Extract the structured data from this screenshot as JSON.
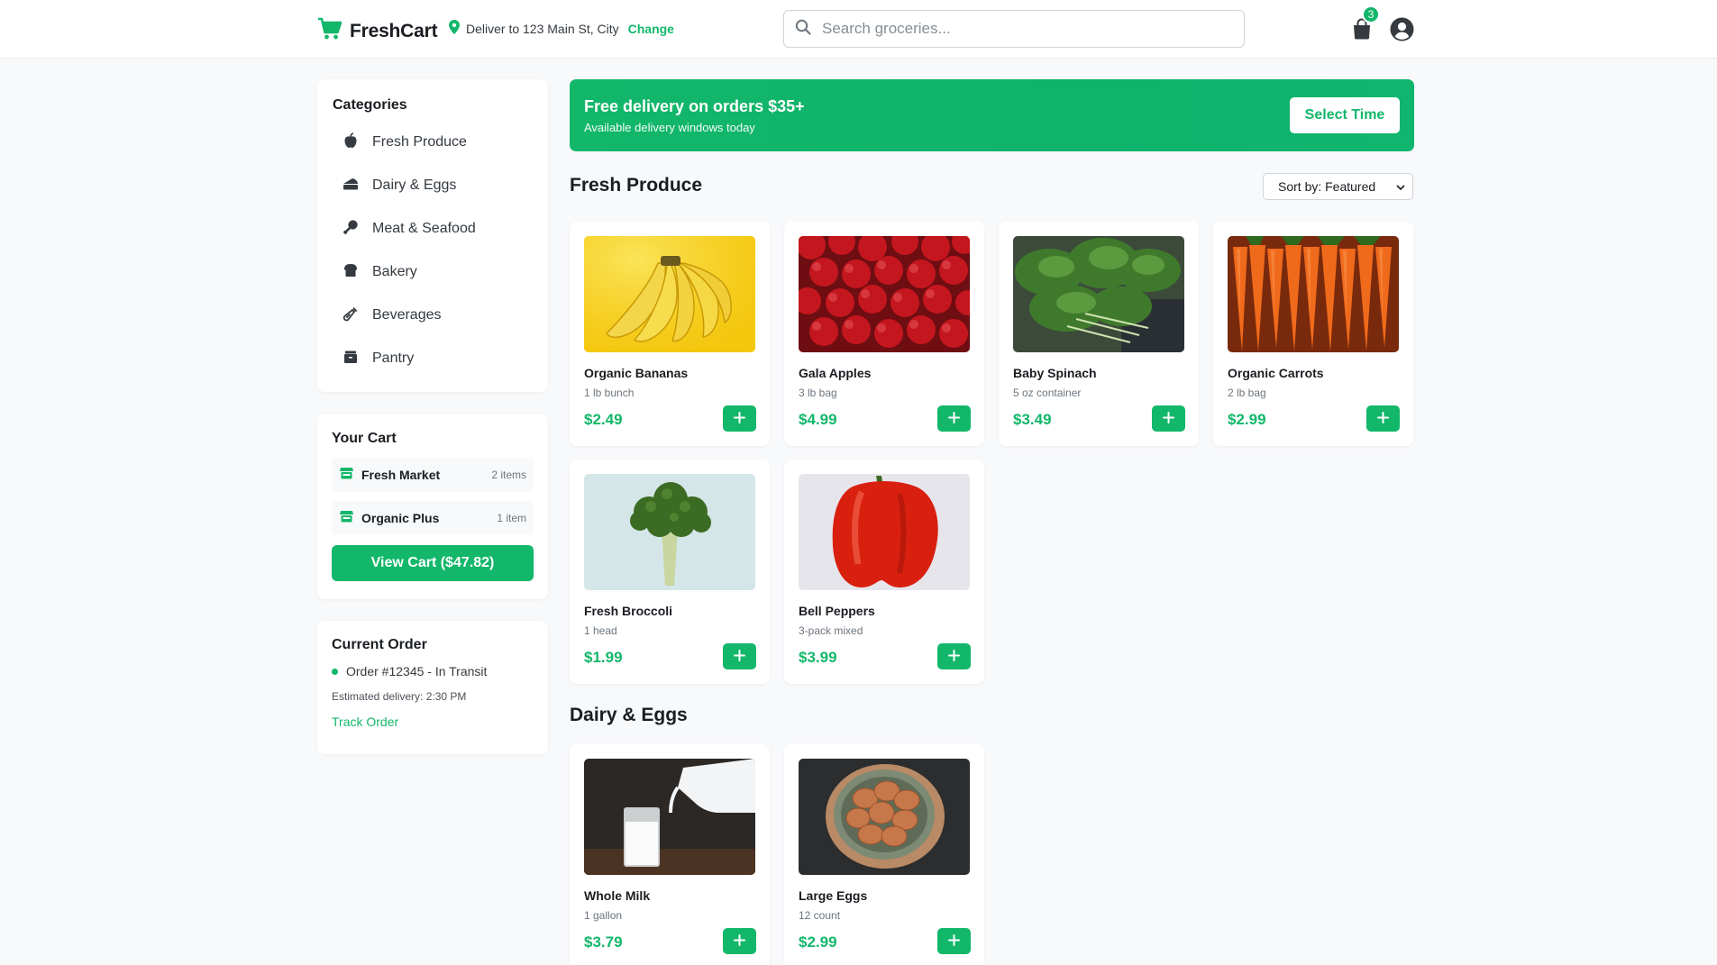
{
  "header": {
    "brand": "FreshCart",
    "deliver_text": "Deliver to 123 Main St, City",
    "change_label": "Change",
    "search_placeholder": "Search groceries...",
    "cart_badge": "3"
  },
  "sidebar": {
    "categories_title": "Categories",
    "categories": [
      {
        "label": "Fresh Produce",
        "icon": "apple-icon"
      },
      {
        "label": "Dairy & Eggs",
        "icon": "cheese-icon"
      },
      {
        "label": "Meat & Seafood",
        "icon": "drumstick-icon"
      },
      {
        "label": "Bakery",
        "icon": "bread-icon"
      },
      {
        "label": "Beverages",
        "icon": "bottle-icon"
      },
      {
        "label": "Pantry",
        "icon": "box-icon"
      }
    ],
    "cart": {
      "title": "Your Cart",
      "stores": [
        {
          "name": "Fresh Market",
          "count": "2 items"
        },
        {
          "name": "Organic Plus",
          "count": "1 item"
        }
      ],
      "view_cart_label": "View Cart ($47.82)"
    },
    "order": {
      "title": "Current Order",
      "status": "Order #12345 - In Transit",
      "eta": "Estimated delivery: 2:30 PM",
      "track_label": "Track Order"
    }
  },
  "promo": {
    "title": "Free delivery on orders $35+",
    "subtitle": "Available delivery windows today",
    "button_label": "Select Time"
  },
  "sections": {
    "produce_title": "Fresh Produce",
    "dairy_title": "Dairy & Eggs",
    "sort_label": "Sort by: Featured"
  },
  "products": {
    "produce": [
      {
        "name": "Organic Bananas",
        "unit": "1 lb bunch",
        "price": "$2.49"
      },
      {
        "name": "Gala Apples",
        "unit": "3 lb bag",
        "price": "$4.99"
      },
      {
        "name": "Baby Spinach",
        "unit": "5 oz container",
        "price": "$3.49"
      },
      {
        "name": "Organic Carrots",
        "unit": "2 lb bag",
        "price": "$2.99"
      },
      {
        "name": "Fresh Broccoli",
        "unit": "1 head",
        "price": "$1.99"
      },
      {
        "name": "Bell Peppers",
        "unit": "3-pack mixed",
        "price": "$3.99"
      }
    ],
    "dairy": [
      {
        "name": "Whole Milk",
        "unit": "1 gallon",
        "price": "$3.79"
      },
      {
        "name": "Large Eggs",
        "unit": "12 count",
        "price": "$2.99"
      }
    ]
  },
  "colors": {
    "accent": "#12b76a",
    "text": "#1a1d21",
    "muted": "#6c757d",
    "background": "#f8f9fa"
  }
}
